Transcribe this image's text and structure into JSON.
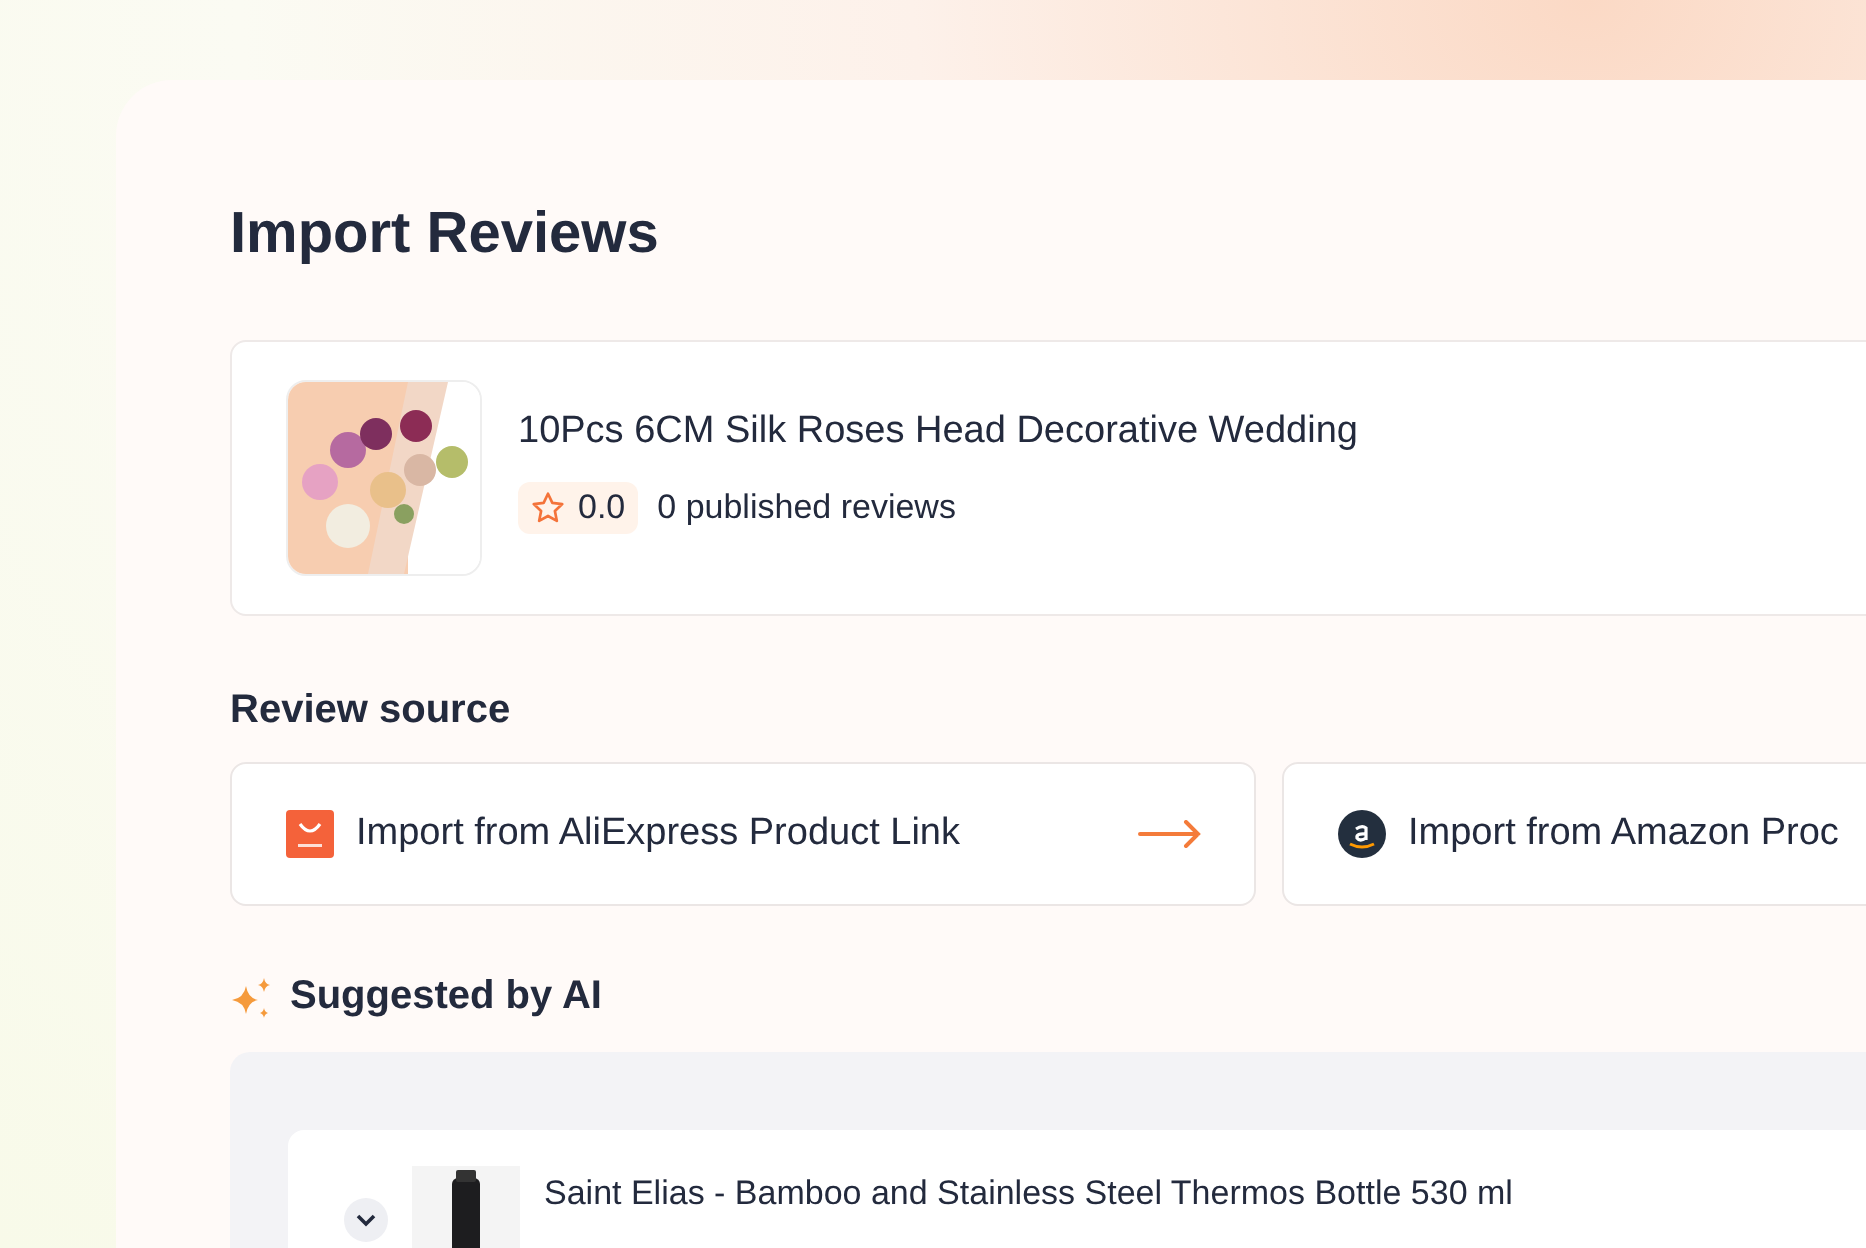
{
  "title": "Import Reviews",
  "product": {
    "kind": "picture",
    "name": "10Pcs 6CM Silk Roses Head Decorative Wedding",
    "rating": "0.0",
    "reviews": "0 published reviews"
  },
  "review_source": {
    "heading": "Review source",
    "sources": [
      {
        "kind": "aliexpress",
        "label": "Import from AliExpress Product Link",
        "arrow": true
      },
      {
        "kind": "amazon",
        "label": "Import from Amazon Proc",
        "arrow": false
      }
    ]
  },
  "suggested": {
    "heading": "Suggested by AI",
    "items": [
      {
        "name": "Saint Elias - Bamboo and Stainless Steel Thermos Bottle 530 ml",
        "expanded": false
      }
    ]
  }
}
